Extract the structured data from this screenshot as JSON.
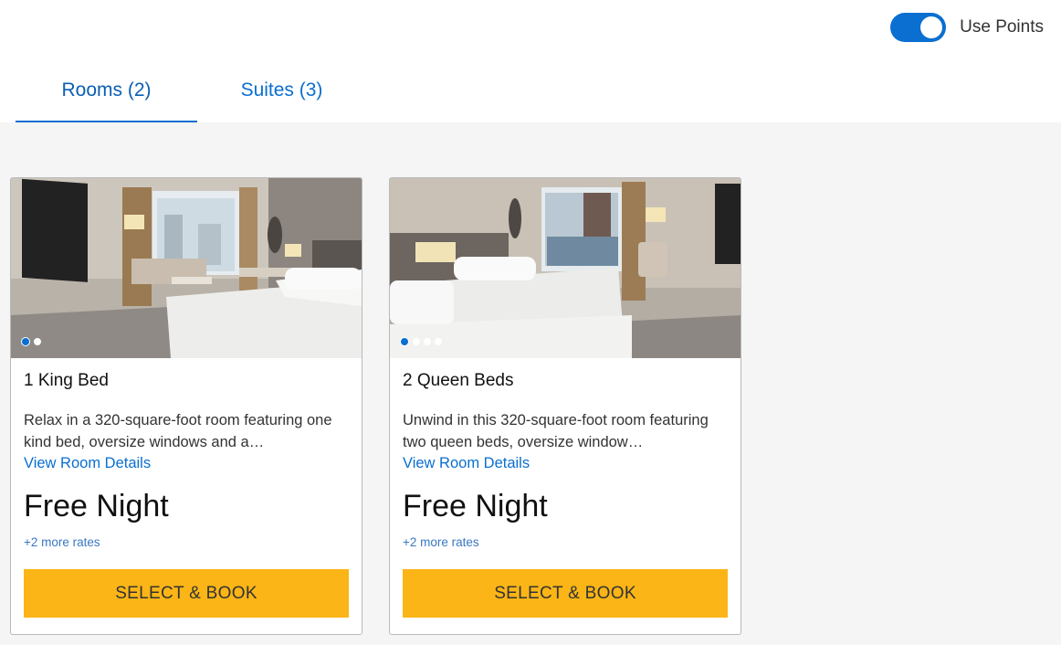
{
  "toggle": {
    "label": "Use Points",
    "on": true
  },
  "tabs": [
    {
      "label": "Rooms (2)",
      "active": true
    },
    {
      "label": "Suites (3)",
      "active": false
    }
  ],
  "rooms": [
    {
      "title": "1 King Bed",
      "description": "Relax in a 320-square-foot room featuring one kind bed, oversize windows and a…",
      "details_link": "View Room Details",
      "price": "Free Night",
      "more_rates": "+2 more rates",
      "button": "SELECT & BOOK",
      "carousel": {
        "count": 2,
        "current": 1
      }
    },
    {
      "title": "2 Queen Beds",
      "description": "Unwind in this 320-square-foot room featuring two queen beds, oversize window…",
      "details_link": "View Room Details",
      "price": "Free Night",
      "more_rates": "+2 more rates",
      "button": "SELECT & BOOK",
      "carousel": {
        "count": 4,
        "current": 1
      }
    }
  ],
  "colors": {
    "accent": "#0a6fd0",
    "button": "#fbb516",
    "background": "#f5f5f5"
  }
}
